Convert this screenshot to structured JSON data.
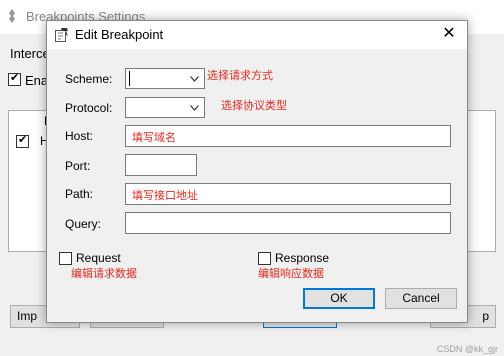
{
  "background_window": {
    "title": "Breakpoints Settings",
    "intercept_label": "Interce",
    "enable_label": "Ena",
    "list_header_fragment": "L",
    "row_text_fragment": "H",
    "buttons": {
      "import": "Imp",
      "help_fragment": "p"
    }
  },
  "dialog": {
    "title": "Edit Breakpoint",
    "close_symbol": "✕",
    "fields": {
      "scheme": {
        "label": "Scheme:",
        "value": "",
        "hint": "选择请求方式"
      },
      "protocol": {
        "label": "Protocol:",
        "value": "",
        "hint": "选择协议类型"
      },
      "host": {
        "label": "Host:",
        "value": "填写域名"
      },
      "port": {
        "label": "Port:",
        "value": ""
      },
      "path": {
        "label": "Path:",
        "value": "填写接口地址"
      },
      "query": {
        "label": "Query:",
        "value": ""
      }
    },
    "request": {
      "label": "Request",
      "hint": "编辑请求数据",
      "checked": false
    },
    "response": {
      "label": "Response",
      "hint": "编辑响应数据",
      "checked": false
    },
    "ok_label": "OK",
    "cancel_label": "Cancel"
  },
  "watermark": "CSDN @kk_gjr",
  "colors": {
    "hint_red": "#e8281c",
    "accent_blue": "#0078d7",
    "dialog_bg": "#f0f0f0"
  },
  "icons": {
    "app": "feather-icon",
    "dialog": "edit-breakpoint-icon",
    "dropdown": "chevron-down-icon",
    "close": "close-icon"
  }
}
